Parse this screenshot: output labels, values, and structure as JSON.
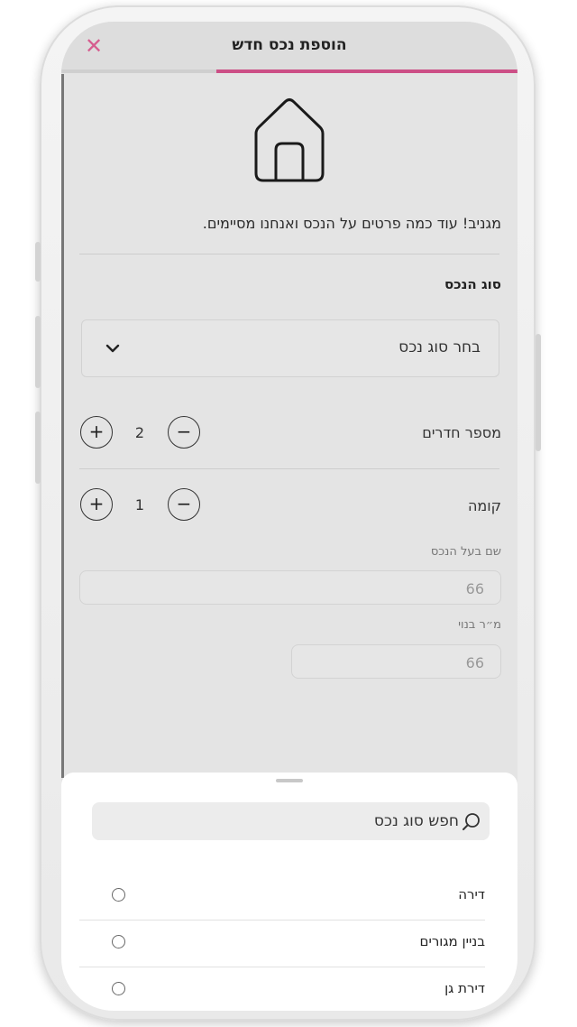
{
  "header": {
    "title": "הוספת נכס חדש",
    "close_icon": "close-icon",
    "progress_fraction": 0.66,
    "accent_color": "#cc4f86"
  },
  "intro": {
    "icon": "home-icon",
    "message": "מגניב! עוד כמה פרטים על הנכס ואנחנו מסיימים."
  },
  "property_type": {
    "label": "סוג הנכס",
    "select_value": "בחר סוג נכס"
  },
  "rooms": {
    "label": "מספר חדרים",
    "value": "2"
  },
  "floor": {
    "label": "קומה",
    "value": "1"
  },
  "owner": {
    "label": "שם בעל הנכס",
    "value": "66"
  },
  "area": {
    "label": "מ״ר בנוי",
    "value": "66"
  },
  "sheet": {
    "search_placeholder": "חפש סוג נכס",
    "options": [
      {
        "label": "דירה"
      },
      {
        "label": "בניין מגורים"
      },
      {
        "label": "דירת גן"
      }
    ]
  }
}
